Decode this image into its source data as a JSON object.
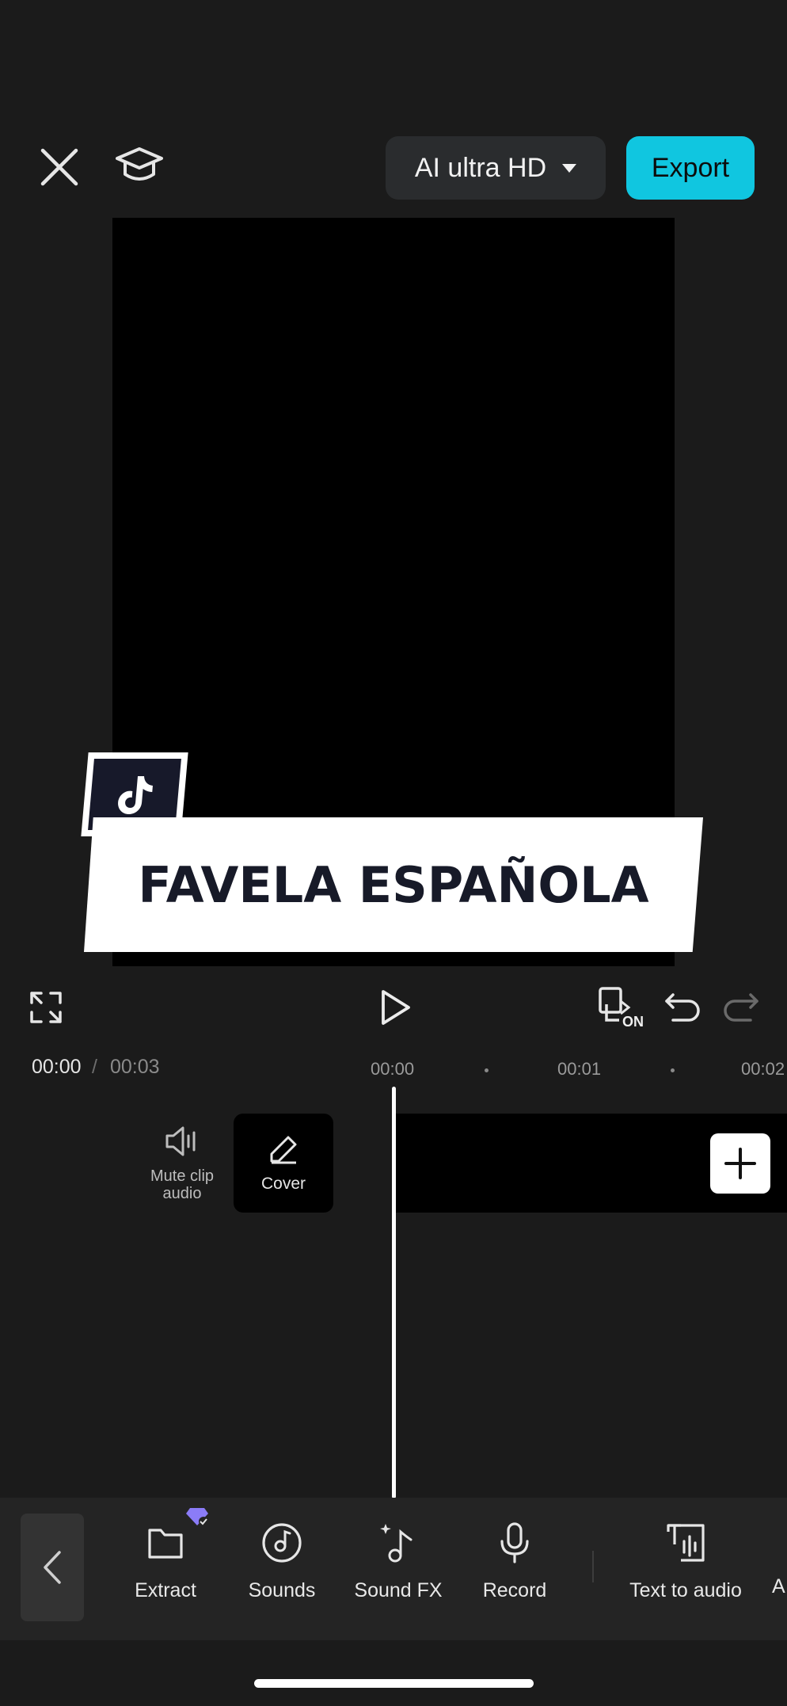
{
  "topbar": {
    "quality_label": "AI ultra HD",
    "export_label": "Export"
  },
  "preview": {
    "title_text": "FAVELA ESPAÑOLA"
  },
  "controls": {
    "clip_toggle_badge": "ON"
  },
  "timeline": {
    "current_time": "00:00",
    "separator": "/",
    "total_time": "00:03",
    "ticks": [
      "00:00",
      "00:01",
      "00:02"
    ],
    "mute_label": "Mute clip audio",
    "cover_label": "Cover"
  },
  "toolbar": {
    "items": [
      {
        "label": "Extract",
        "icon": "folder-icon",
        "premium": true
      },
      {
        "label": "Sounds",
        "icon": "music-disc-icon"
      },
      {
        "label": "Sound FX",
        "icon": "sound-fx-icon"
      },
      {
        "label": "Record",
        "icon": "microphone-icon"
      },
      {
        "label": "Text to audio",
        "icon": "text-to-audio-icon"
      },
      {
        "label": "A",
        "icon": ""
      }
    ]
  },
  "colors": {
    "accent": "#10c6e0",
    "background": "#1b1b1b",
    "toolbar": "#242424",
    "premium": "#8b7cf7"
  }
}
